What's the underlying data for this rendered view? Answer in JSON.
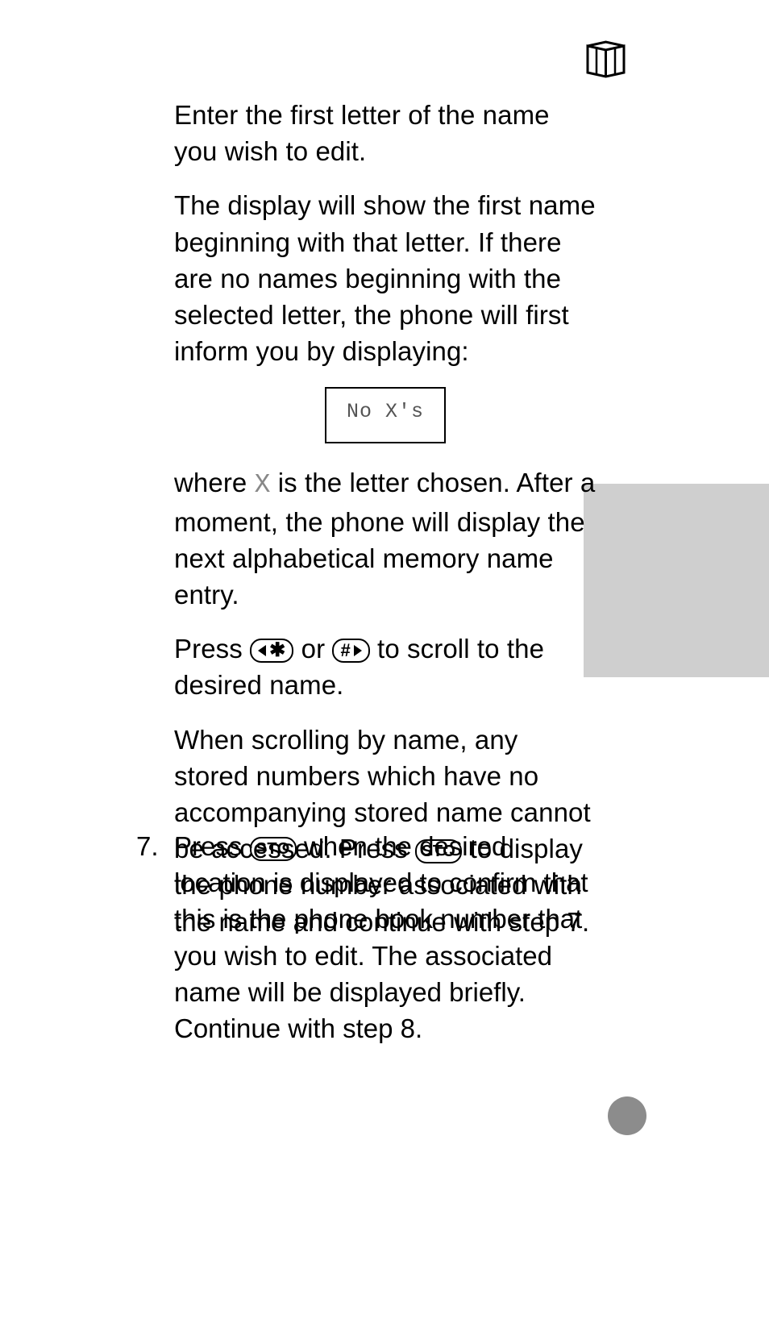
{
  "icons": {
    "book": "book-icon"
  },
  "paragraphs": {
    "p1": "Enter the first letter of the name you wish to edit.",
    "p2": "The display will show the first name beginning with that letter. If there are no names beginning with the selected letter, the phone will first inform you by displaying:",
    "display_text": "No X's",
    "p3_a": "where ",
    "p3_mono": "X",
    "p3_b": " is the letter chosen. After a moment, the phone will display the next alphabetical memory name entry.",
    "p4_a": "Press ",
    "p4_b": " or ",
    "p4_c": " to scroll to the desired name.",
    "p5_a": "When scrolling by name, any stored numbers which have no accompanying stored name cannot be accessed. Press ",
    "p5_b": " to display the phone number associated with the name and continue with step 7."
  },
  "keys": {
    "star_key": "✱",
    "hash_key": "#",
    "sto": "STO"
  },
  "step": {
    "number": "7.",
    "body_a": "Press ",
    "body_b": " when the desired location is displayed to confirm that this is the phone book number that you wish to edit. The associated name will be displayed briefly. Continue with step 8."
  }
}
